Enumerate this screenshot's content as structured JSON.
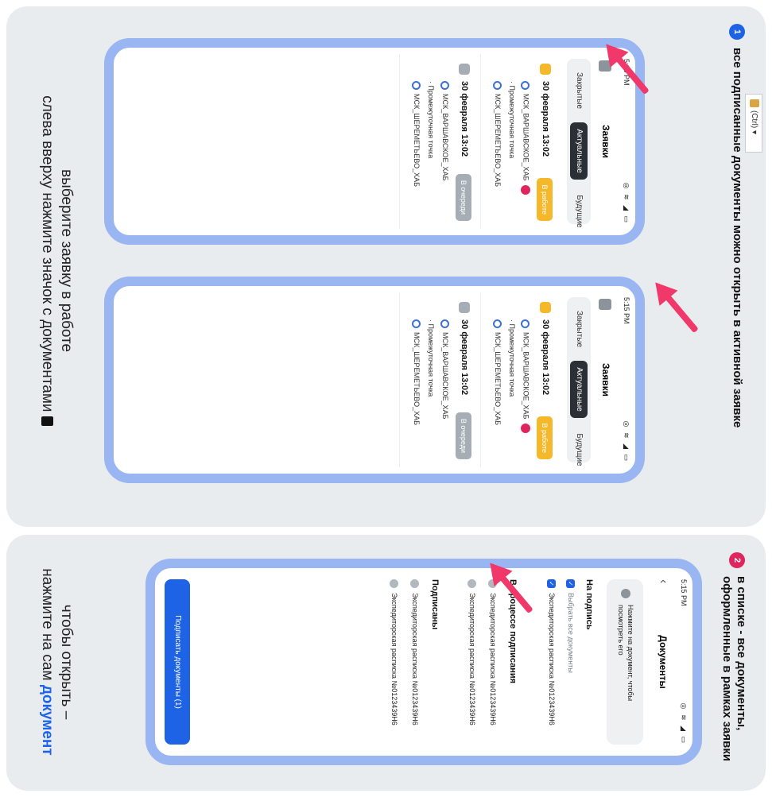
{
  "step1": {
    "number": "1",
    "heading": "все подписанные документы можно открыть в активной заявке",
    "caption_lines": [
      "выберите заявку в работе",
      "слева вверху нажмите значок с документами"
    ],
    "ctrl_label": "(Ctrl)",
    "phones": [
      {
        "time": "5:15 PM",
        "title": "Заявки",
        "tabs": [
          "Закрытые",
          "Актуальные",
          "Будущие"
        ],
        "cards": [
          {
            "date": "30 февраля 13:02",
            "badge": "В работе",
            "stops": [
              "МСК_ВАРШАВСКОЕ_ХАБ",
              "Промежуточная точка",
              "МСК_ШЕРЕМЕТЬЕВО_ХАБ"
            ]
          },
          {
            "date": "30 февраля 13:02",
            "badge": "В очереди",
            "stops": [
              "МСК_ВАРШАВСКОЕ_ХАБ",
              "Промежуточная точка",
              "МСК_ШЕРЕМЕТЬЕВО_ХАБ"
            ]
          }
        ]
      },
      {
        "time": "5:15 PM",
        "title": "Заявки",
        "tabs": [
          "Закрытые",
          "Актуальные",
          "Будущие"
        ],
        "cards": [
          {
            "date": "30 февраля 13:02",
            "badge": "В работе",
            "stops": [
              "МСК_ВАРШАВСКОЕ_ХАБ",
              "Промежуточная точка",
              "МСК_ШЕРЕМЕТЬЕВО_ХАБ"
            ]
          },
          {
            "date": "30 февраля 13:02",
            "badge": "В очереди",
            "stops": [
              "МСК_ВАРШАВСКОЕ_ХАБ",
              "Промежуточная точка",
              "МСК_ШЕРЕМЕТЬЕВО_ХАБ"
            ]
          }
        ]
      }
    ]
  },
  "step2": {
    "number": "2",
    "heading_lines": [
      "в списке - все документы,",
      "оформленные в рамках заявки"
    ],
    "caption_line1": "чтобы открыть –",
    "caption_line2_prefix": "нажмите на сам",
    "caption_link": "документ",
    "phone": {
      "time": "5:15 PM",
      "title": "Документы",
      "hint": "Нажмите на документ, чтобы посмотреть его",
      "sections": [
        {
          "title": "На подпись",
          "select_all": "Выбрать все документы",
          "items": [
            "Экспедиторская расписка №0123439Н6"
          ]
        },
        {
          "title": "В процессе подписания",
          "items": [
            "Экспедиторская расписка №0123439Н6",
            "Экспедиторская расписка №0123439Н6"
          ]
        },
        {
          "title": "Подписаны",
          "items": [
            "Экспедиторская расписка №0123439Н6",
            "Экспедиторская расписка №0123439Н6"
          ]
        }
      ],
      "button": "Подписать документы (1)"
    }
  },
  "colors": {
    "accent_blue": "#1e63e6",
    "arrow_pink": "#f0386b",
    "frame_blue": "#99b6f2",
    "badge_yellow": "#f5b82a",
    "panel_bg": "#e9ecef"
  }
}
